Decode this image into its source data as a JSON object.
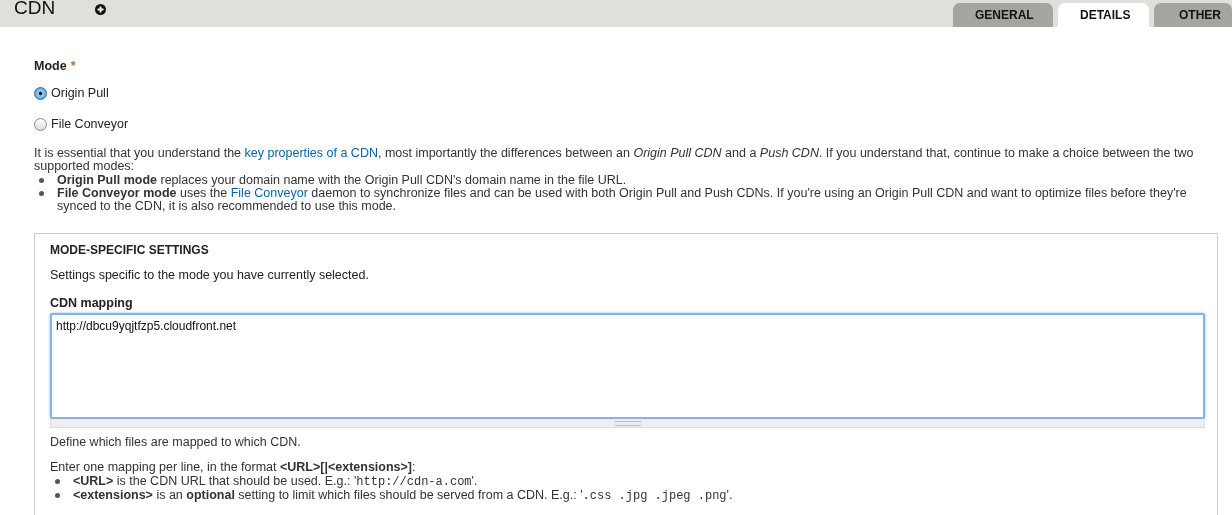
{
  "header": {
    "title": "CDN"
  },
  "tabs": [
    {
      "label": "GENERAL",
      "selected": false
    },
    {
      "label": "DETAILS",
      "selected": true
    },
    {
      "label": "OTHER",
      "selected": false
    }
  ],
  "mode": {
    "label": "Mode",
    "required_mark": "*",
    "options": [
      {
        "label": "Origin Pull",
        "selected": true
      },
      {
        "label": "File Conveyor",
        "selected": false
      }
    ]
  },
  "description": {
    "parts": [
      {
        "kind": "text",
        "text": "It is essential that you understand the "
      },
      {
        "kind": "link",
        "text": "key properties of a CDN"
      },
      {
        "kind": "text",
        "text": ", most importantly the differences between an *Origin Pull CDN* and a *Push CDN*. If you understand that, continue to make a choice between the two supported modes:"
      }
    ],
    "bullets": [
      {
        "parts": [
          {
            "kind": "text",
            "text": "**Origin Pull mode** replaces your domain name with the Origin Pull CDN's domain name in the file URL."
          }
        ]
      },
      {
        "parts": [
          {
            "kind": "text",
            "text": "**File Conveyor mode** uses the "
          },
          {
            "kind": "link",
            "text": "File Conveyor"
          },
          {
            "kind": "text",
            "text": " daemon to synchronize files and can be used with both Origin Pull and Push CDNs. If you're using an Origin Pull CDN and want to optimize files before they're synced to the CDN, it is also recommended to use this mode."
          }
        ]
      }
    ]
  },
  "fieldset": {
    "legend": "MODE-SPECIFIC SETTINGS",
    "intro": "Settings specific to the mode you have currently selected.",
    "mapping": {
      "label": "CDN mapping",
      "value": "http://dbcu9yqjtfzp5.cloudfront.net",
      "help": "Define which files are mapped to which CDN.",
      "format": {
        "parts": [
          {
            "kind": "text",
            "text": "Enter one mapping per line, in the format **<URL>[|<extensions>]**:"
          }
        ],
        "bullets": [
          {
            "parts": [
              {
                "kind": "text",
                "text": "**<URL>** is the CDN URL that should be used. E.g.: '"
              },
              {
                "kind": "code",
                "text": "http://cdn-a.com"
              },
              {
                "kind": "text",
                "text": "'."
              }
            ]
          },
          {
            "parts": [
              {
                "kind": "text",
                "text": "**<extensions>** is an **optional** setting to limit which files should be served from a CDN. E.g.: '"
              },
              {
                "kind": "code",
                "text": ".css .jpg .jpeg .png"
              },
              {
                "kind": "text",
                "text": "'."
              }
            ]
          }
        ]
      }
    }
  }
}
